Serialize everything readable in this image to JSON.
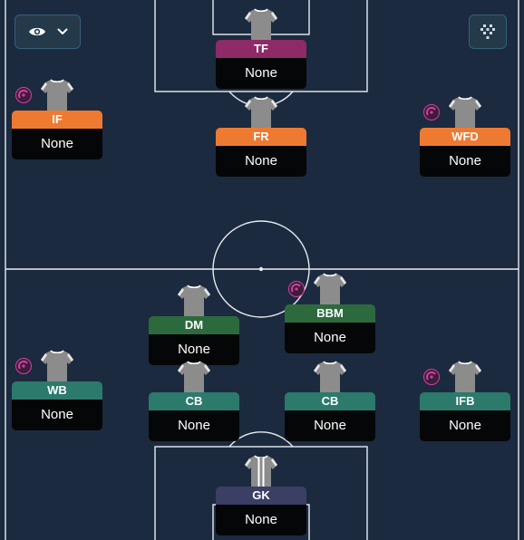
{
  "toolbar": {
    "view_toggle": {
      "eye_icon": "eye-icon",
      "dropdown_icon": "chevron-down-icon"
    },
    "formation_toggle": {
      "icon": "formation-grid-icon"
    }
  },
  "colors": {
    "pitch": "#1c2a3f",
    "lines": "#e8ecf2",
    "attack": "#ee7a32",
    "striker": "#8d2a67",
    "midfield": "#2c6a3e",
    "defence": "#2c7a6c",
    "goalkeeper": "#3b3f63",
    "player_bg": "#050607",
    "shirt": "#8c8c8c",
    "badge": "#d63da1"
  },
  "positions": [
    {
      "id": "tf",
      "role": "TF",
      "player": "None",
      "group": "striker",
      "badge": false
    },
    {
      "id": "if",
      "role": "IF",
      "player": "None",
      "group": "attack",
      "badge": true
    },
    {
      "id": "fr",
      "role": "FR",
      "player": "None",
      "group": "attack",
      "badge": false
    },
    {
      "id": "wfd",
      "role": "WFD",
      "player": "None",
      "group": "attack",
      "badge": true
    },
    {
      "id": "dm",
      "role": "DM",
      "player": "None",
      "group": "midfield",
      "badge": false
    },
    {
      "id": "bbm",
      "role": "BBM",
      "player": "None",
      "group": "midfield",
      "badge": true
    },
    {
      "id": "wb",
      "role": "WB",
      "player": "None",
      "group": "defence",
      "badge": true
    },
    {
      "id": "cb-left",
      "role": "CB",
      "player": "None",
      "group": "defence",
      "badge": false
    },
    {
      "id": "cb-right",
      "role": "CB",
      "player": "None",
      "group": "defence",
      "badge": false
    },
    {
      "id": "ifb",
      "role": "IFB",
      "player": "None",
      "group": "defence",
      "badge": true
    },
    {
      "id": "gk",
      "role": "GK",
      "player": "None",
      "group": "goalkeeper",
      "badge": false
    }
  ]
}
